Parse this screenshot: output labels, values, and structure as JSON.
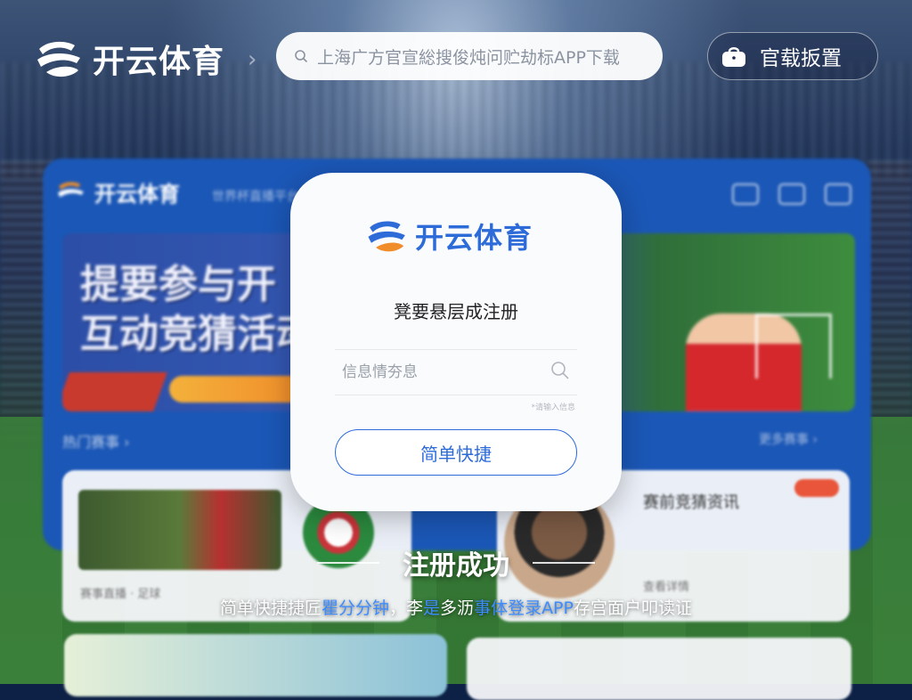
{
  "header": {
    "brand": "开云体育",
    "search_text": "上海广方官宣総搜俊炖问贮劫标APP下载",
    "app_button_label": "官载扳置"
  },
  "background_app": {
    "brand": "开云体育",
    "subtitle": "世界杯直播平台",
    "banner_line1": "提要参与开",
    "banner_line2": "互动竞猜活动",
    "section_left": "热门赛事 ›",
    "section_right": "更多赛事 ›",
    "card1_meta": "赛事直播 · 足球",
    "card2_title": "赛前竞猜资讯",
    "card2_meta": "查看详情"
  },
  "modal": {
    "brand": "开云体育",
    "message": "凳要悬层成注册",
    "input_placeholder": "信息情夯息",
    "input_value": "",
    "hint": "*请输入信息",
    "button_label": "简单快捷"
  },
  "success": {
    "title": "注册成功"
  },
  "caption": {
    "part1": "简单快捷捷匠",
    "highlight1": "瞿分分钟",
    "part2": "，李",
    "highlight2": "是",
    "part3": "多沥",
    "highlight3": "事体登录APP",
    "part4": "存宫面户叩读证"
  },
  "colors": {
    "brand_blue": "#2d6bd9",
    "brand_orange": "#f08d2a",
    "highlight_blue": "#3d8cff"
  },
  "icons": {
    "search": "search-icon",
    "app": "bag-icon",
    "chevron": "chevron-right-icon"
  }
}
